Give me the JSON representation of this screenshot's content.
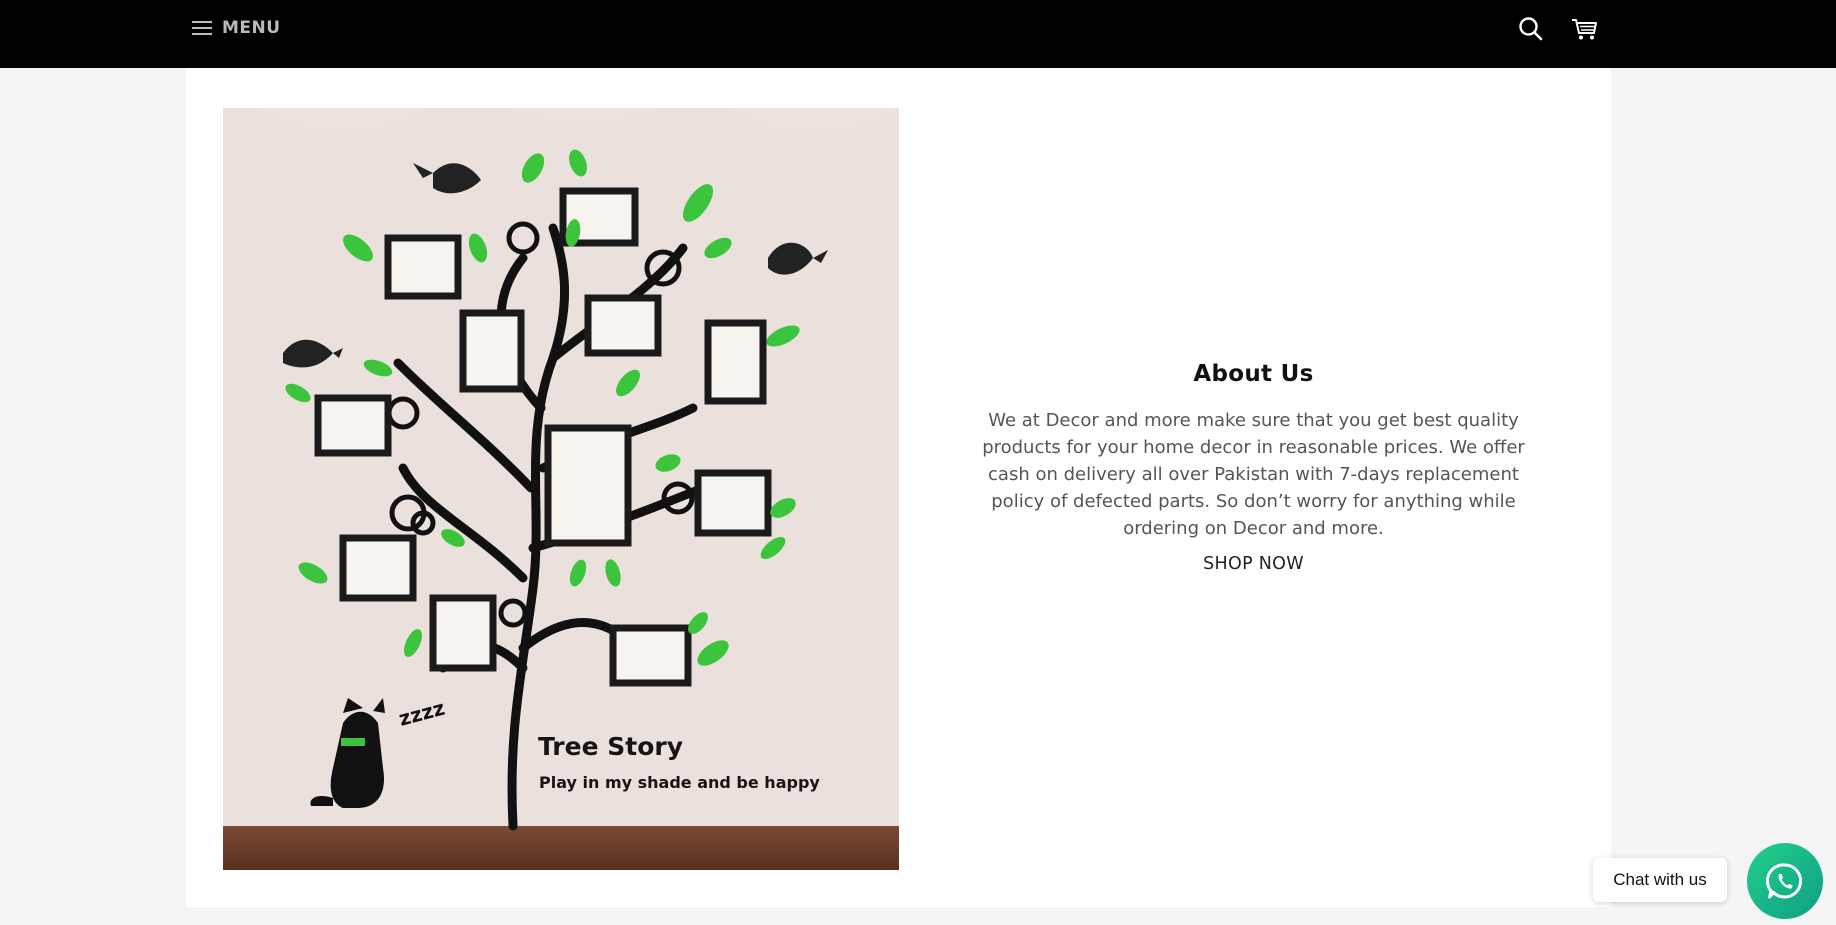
{
  "header": {
    "menu_label": "MENU",
    "icons": [
      "hamburger-icon",
      "search-icon",
      "cart-icon"
    ]
  },
  "hero_image": {
    "headline": "Tree Story",
    "tagline": "Play in my shade and be happy",
    "snore": "zzzz"
  },
  "about": {
    "title": "About Us",
    "body": "We at Decor and more make sure that you get best quality products for your home decor in reasonable prices. We offer cash on delivery all over Pakistan with 7-days replacement policy of defected parts. So don’t worry for anything while ordering on Decor and more.",
    "cta": "SHOP NOW"
  },
  "chat": {
    "label": "Chat with us",
    "icon": "whatsapp-icon"
  },
  "colors": {
    "header_bg": "#000000",
    "page_bg": "#f5f5f5",
    "leaf_green": "#3cc43c",
    "whatsapp": "#1fb98a"
  }
}
